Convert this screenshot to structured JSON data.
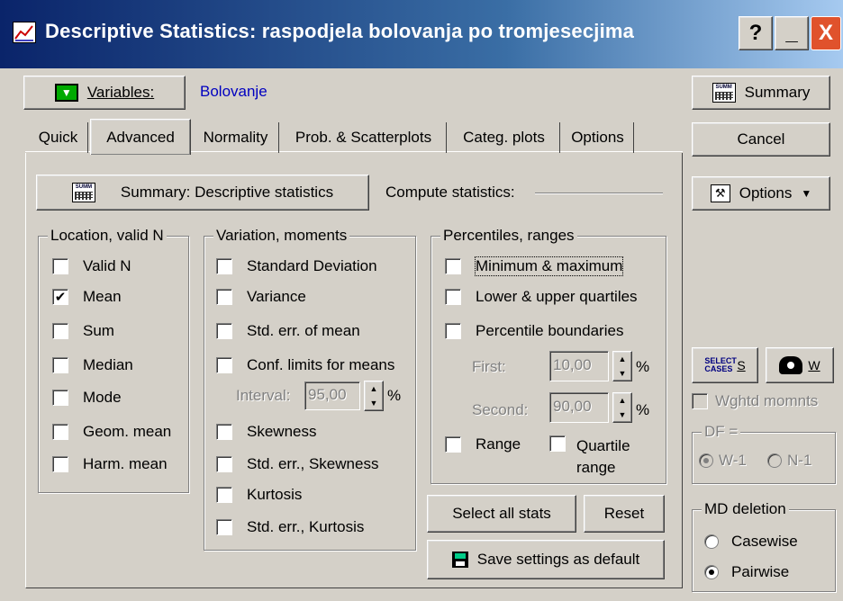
{
  "window": {
    "title": "Descriptive Statistics: raspodjela bolovanja po tromjesecjima",
    "help_label": "?",
    "minimize_label": "_",
    "close_label": "X"
  },
  "variables": {
    "button_label": "Variables:",
    "value": "Bolovanje"
  },
  "tabs": [
    "Quick",
    "Advanced",
    "Normality",
    "Prob. & Scatterplots",
    "Categ. plots",
    "Options"
  ],
  "active_tab": "Advanced",
  "summary_desc_button": "Summary: Descriptive statistics",
  "compute_label": "Compute statistics:",
  "location": {
    "title": "Location, valid N",
    "items": [
      {
        "label": "Valid N",
        "checked": false
      },
      {
        "label": "Mean",
        "checked": true
      },
      {
        "label": "Sum",
        "checked": false
      },
      {
        "label": "Median",
        "checked": false
      },
      {
        "label": "Mode",
        "checked": false
      },
      {
        "label": "Geom. mean",
        "checked": false
      },
      {
        "label": "Harm. mean",
        "checked": false
      }
    ]
  },
  "variation": {
    "title": "Variation, moments",
    "items": [
      {
        "label": "Standard Deviation",
        "checked": false
      },
      {
        "label": "Variance",
        "checked": false
      },
      {
        "label": "Std. err. of mean",
        "checked": false
      },
      {
        "label": "Conf. limits for means",
        "checked": false
      }
    ],
    "interval_label": "Interval:",
    "interval_value": "95,00",
    "percent": "%",
    "items2": [
      {
        "label": "Skewness",
        "checked": false
      },
      {
        "label": "Std. err., Skewness",
        "checked": false
      },
      {
        "label": "Kurtosis",
        "checked": false
      },
      {
        "label": "Std. err., Kurtosis",
        "checked": false
      }
    ]
  },
  "percentiles": {
    "title": "Percentiles, ranges",
    "items": [
      {
        "label": "Minimum & maximum",
        "checked": false
      },
      {
        "label": "Lower & upper quartiles",
        "checked": false
      },
      {
        "label": "Percentile boundaries",
        "checked": false
      }
    ],
    "first_label": "First:",
    "first_value": "10,00",
    "second_label": "Second:",
    "second_value": "90,00",
    "percent": "%",
    "range_label": "Range",
    "quartile_range_line1": "Quartile",
    "quartile_range_line2": "range"
  },
  "select_all_label": "Select all stats",
  "reset_label": "Reset",
  "save_default_label": "Save settings as default",
  "right": {
    "summary_label": "Summary",
    "cancel_label": "Cancel",
    "options_label": "Options",
    "select_cases_icon_text": "SELECT CASES",
    "select_cases_shortcut": "S",
    "weight_shortcut": "W",
    "wghtd_label": "Wghtd momnts",
    "df_title": "DF =",
    "df_w1": "W-1",
    "df_n1": "N-1",
    "md_title": "MD deletion",
    "casewise": "Casewise",
    "pairwise": "Pairwise",
    "md_selected": "Pairwise"
  },
  "icon_summary_text": "SUMM"
}
